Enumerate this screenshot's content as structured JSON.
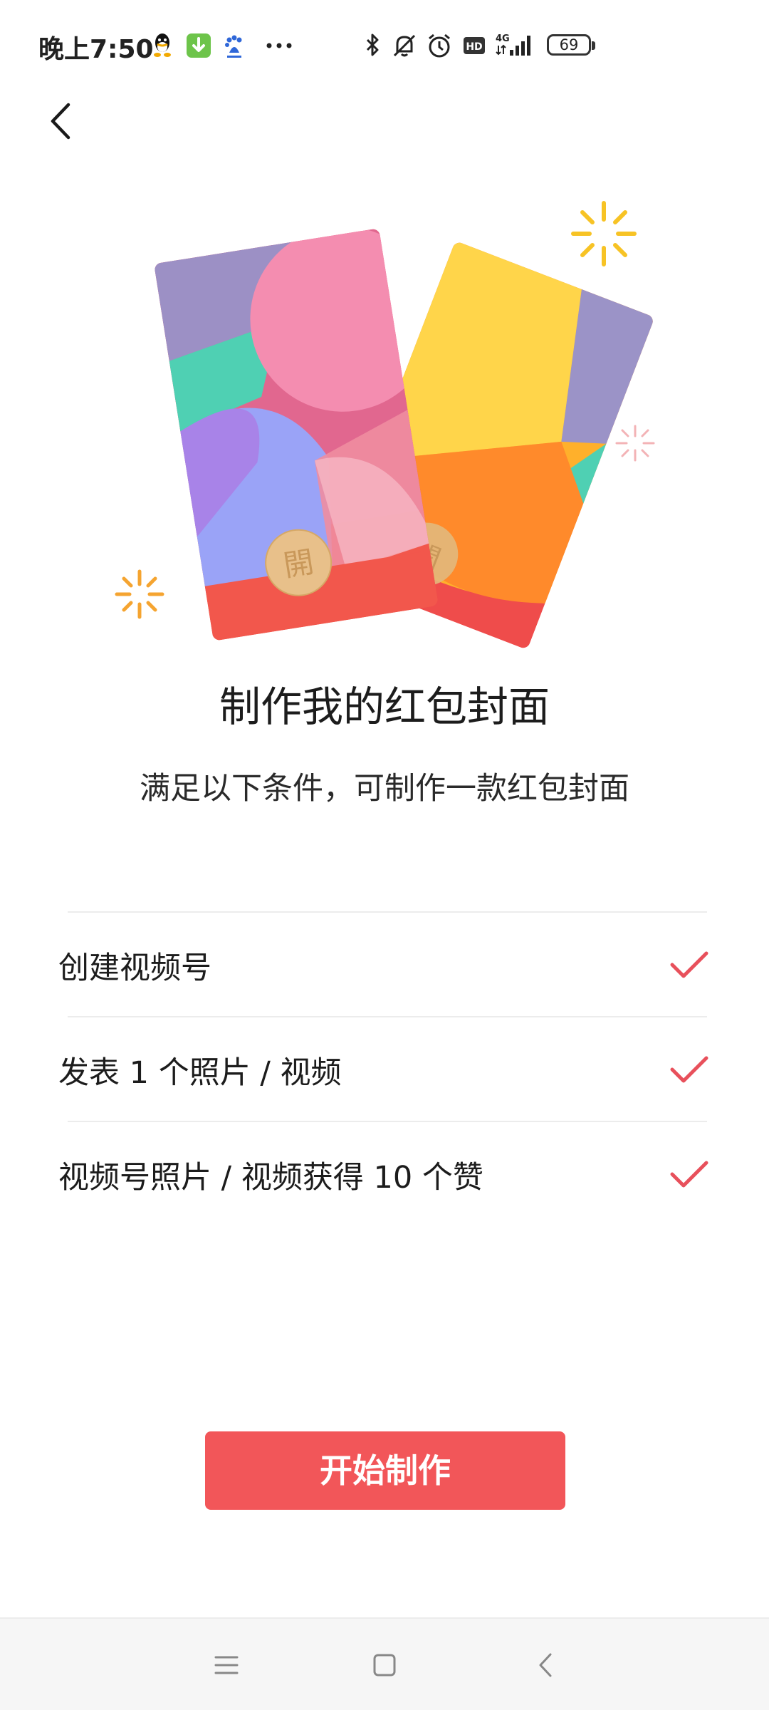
{
  "status_bar": {
    "time": "晚上7:50",
    "battery": "69",
    "icons": [
      "qq-icon",
      "download-icon",
      "baidu-icon",
      "more-dots-icon",
      "bluetooth-icon",
      "mute-icon",
      "alarm-icon",
      "hd-icon",
      "signal-4g-icon",
      "battery-icon"
    ],
    "network": "4G",
    "hd": "HD"
  },
  "header": {
    "back_icon": "chevron-left-icon"
  },
  "illustration": {
    "card_seal_text": "開",
    "icon": "red-envelope-cards-illustration"
  },
  "main": {
    "title": "制作我的红包封面",
    "subtitle": "满足以下条件，可制作一款红包封面"
  },
  "requirements": [
    {
      "label": "创建视频号",
      "done": true
    },
    {
      "label": "发表 1 个照片 / 视频",
      "done": true
    },
    {
      "label": "视频号照片 / 视频获得 10 个赞",
      "done": true
    }
  ],
  "actions": {
    "start_label": "开始制作"
  },
  "colors": {
    "accent": "#f25659",
    "check": "#e8505b"
  },
  "nav_bar": {
    "icons": [
      "menu-icon",
      "home-square-icon",
      "back-triangle-icon"
    ]
  }
}
